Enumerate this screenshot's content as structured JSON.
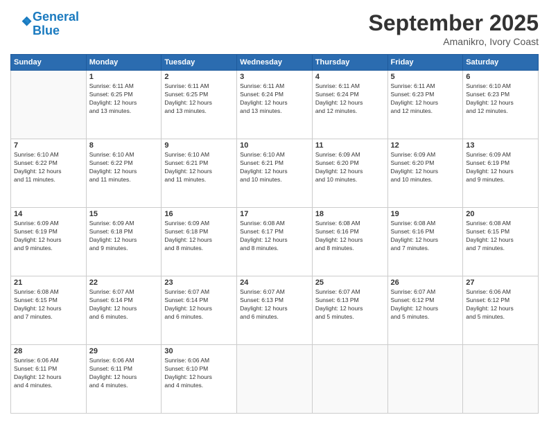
{
  "header": {
    "logo_line1": "General",
    "logo_line2": "Blue",
    "month": "September 2025",
    "location": "Amanikro, Ivory Coast"
  },
  "days_of_week": [
    "Sunday",
    "Monday",
    "Tuesday",
    "Wednesday",
    "Thursday",
    "Friday",
    "Saturday"
  ],
  "weeks": [
    [
      {
        "day": "",
        "info": ""
      },
      {
        "day": "1",
        "info": "Sunrise: 6:11 AM\nSunset: 6:25 PM\nDaylight: 12 hours\nand 13 minutes."
      },
      {
        "day": "2",
        "info": "Sunrise: 6:11 AM\nSunset: 6:25 PM\nDaylight: 12 hours\nand 13 minutes."
      },
      {
        "day": "3",
        "info": "Sunrise: 6:11 AM\nSunset: 6:24 PM\nDaylight: 12 hours\nand 13 minutes."
      },
      {
        "day": "4",
        "info": "Sunrise: 6:11 AM\nSunset: 6:24 PM\nDaylight: 12 hours\nand 12 minutes."
      },
      {
        "day": "5",
        "info": "Sunrise: 6:11 AM\nSunset: 6:23 PM\nDaylight: 12 hours\nand 12 minutes."
      },
      {
        "day": "6",
        "info": "Sunrise: 6:10 AM\nSunset: 6:23 PM\nDaylight: 12 hours\nand 12 minutes."
      }
    ],
    [
      {
        "day": "7",
        "info": "Sunrise: 6:10 AM\nSunset: 6:22 PM\nDaylight: 12 hours\nand 11 minutes."
      },
      {
        "day": "8",
        "info": "Sunrise: 6:10 AM\nSunset: 6:22 PM\nDaylight: 12 hours\nand 11 minutes."
      },
      {
        "day": "9",
        "info": "Sunrise: 6:10 AM\nSunset: 6:21 PM\nDaylight: 12 hours\nand 11 minutes."
      },
      {
        "day": "10",
        "info": "Sunrise: 6:10 AM\nSunset: 6:21 PM\nDaylight: 12 hours\nand 10 minutes."
      },
      {
        "day": "11",
        "info": "Sunrise: 6:09 AM\nSunset: 6:20 PM\nDaylight: 12 hours\nand 10 minutes."
      },
      {
        "day": "12",
        "info": "Sunrise: 6:09 AM\nSunset: 6:20 PM\nDaylight: 12 hours\nand 10 minutes."
      },
      {
        "day": "13",
        "info": "Sunrise: 6:09 AM\nSunset: 6:19 PM\nDaylight: 12 hours\nand 9 minutes."
      }
    ],
    [
      {
        "day": "14",
        "info": "Sunrise: 6:09 AM\nSunset: 6:19 PM\nDaylight: 12 hours\nand 9 minutes."
      },
      {
        "day": "15",
        "info": "Sunrise: 6:09 AM\nSunset: 6:18 PM\nDaylight: 12 hours\nand 9 minutes."
      },
      {
        "day": "16",
        "info": "Sunrise: 6:09 AM\nSunset: 6:18 PM\nDaylight: 12 hours\nand 8 minutes."
      },
      {
        "day": "17",
        "info": "Sunrise: 6:08 AM\nSunset: 6:17 PM\nDaylight: 12 hours\nand 8 minutes."
      },
      {
        "day": "18",
        "info": "Sunrise: 6:08 AM\nSunset: 6:16 PM\nDaylight: 12 hours\nand 8 minutes."
      },
      {
        "day": "19",
        "info": "Sunrise: 6:08 AM\nSunset: 6:16 PM\nDaylight: 12 hours\nand 7 minutes."
      },
      {
        "day": "20",
        "info": "Sunrise: 6:08 AM\nSunset: 6:15 PM\nDaylight: 12 hours\nand 7 minutes."
      }
    ],
    [
      {
        "day": "21",
        "info": "Sunrise: 6:08 AM\nSunset: 6:15 PM\nDaylight: 12 hours\nand 7 minutes."
      },
      {
        "day": "22",
        "info": "Sunrise: 6:07 AM\nSunset: 6:14 PM\nDaylight: 12 hours\nand 6 minutes."
      },
      {
        "day": "23",
        "info": "Sunrise: 6:07 AM\nSunset: 6:14 PM\nDaylight: 12 hours\nand 6 minutes."
      },
      {
        "day": "24",
        "info": "Sunrise: 6:07 AM\nSunset: 6:13 PM\nDaylight: 12 hours\nand 6 minutes."
      },
      {
        "day": "25",
        "info": "Sunrise: 6:07 AM\nSunset: 6:13 PM\nDaylight: 12 hours\nand 5 minutes."
      },
      {
        "day": "26",
        "info": "Sunrise: 6:07 AM\nSunset: 6:12 PM\nDaylight: 12 hours\nand 5 minutes."
      },
      {
        "day": "27",
        "info": "Sunrise: 6:06 AM\nSunset: 6:12 PM\nDaylight: 12 hours\nand 5 minutes."
      }
    ],
    [
      {
        "day": "28",
        "info": "Sunrise: 6:06 AM\nSunset: 6:11 PM\nDaylight: 12 hours\nand 4 minutes."
      },
      {
        "day": "29",
        "info": "Sunrise: 6:06 AM\nSunset: 6:11 PM\nDaylight: 12 hours\nand 4 minutes."
      },
      {
        "day": "30",
        "info": "Sunrise: 6:06 AM\nSunset: 6:10 PM\nDaylight: 12 hours\nand 4 minutes."
      },
      {
        "day": "",
        "info": ""
      },
      {
        "day": "",
        "info": ""
      },
      {
        "day": "",
        "info": ""
      },
      {
        "day": "",
        "info": ""
      }
    ]
  ]
}
